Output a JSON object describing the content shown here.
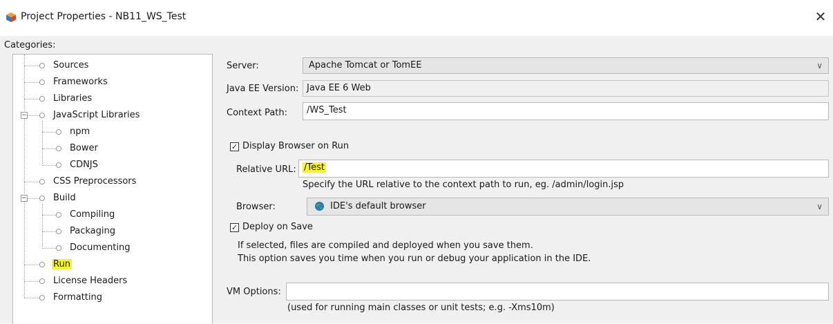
{
  "window": {
    "title": "Project Properties - NB11_WS_Test",
    "close_glyph": "✕"
  },
  "categories": {
    "label": "Categories:",
    "items": [
      {
        "label": "Sources"
      },
      {
        "label": "Frameworks"
      },
      {
        "label": "Libraries"
      },
      {
        "label": "JavaScript Libraries",
        "expanded": true
      },
      {
        "label": "npm"
      },
      {
        "label": "Bower"
      },
      {
        "label": "CDNJS"
      },
      {
        "label": "CSS Preprocessors"
      },
      {
        "label": "Build",
        "expanded": true
      },
      {
        "label": "Compiling"
      },
      {
        "label": "Packaging"
      },
      {
        "label": "Documenting"
      },
      {
        "label": "Run",
        "selected": true
      },
      {
        "label": "License Headers"
      },
      {
        "label": "Formatting"
      }
    ],
    "expander_glyph": "−"
  },
  "run_panel": {
    "server_label": "Server:",
    "server_value": "Apache Tomcat or TomEE",
    "javaee_label": "Java EE Version:",
    "javaee_value": "Java EE 6 Web",
    "context_label": "Context Path:",
    "context_value": "/WS_Test",
    "display_browser_label": "Display Browser on Run",
    "display_browser_checked": true,
    "relative_url_label": "Relative URL:",
    "relative_url_value": "/Test",
    "relative_url_help": "Specify the URL relative to the context path to run, eg. /admin/login.jsp",
    "browser_label": "Browser:",
    "browser_value": "IDE's default browser",
    "deploy_label": "Deploy on Save",
    "deploy_checked": true,
    "deploy_help_1": "If selected, files are compiled and deployed when you save them.",
    "deploy_help_2": "This option saves you time when you run or debug your application in the IDE.",
    "vm_label": "VM Options:",
    "vm_value": "",
    "vm_help": "(used for running main classes or unit tests; e.g. -Xms10m)",
    "dropdown_glyph": "∨",
    "check_glyph": "✓"
  },
  "colors": {
    "highlight": "#f5f528",
    "panel_bg": "#f0f0f0",
    "border": "#b9b9b9"
  }
}
